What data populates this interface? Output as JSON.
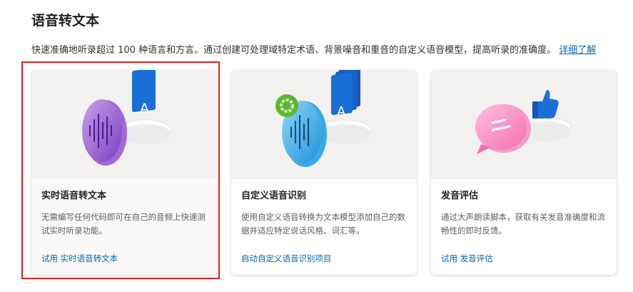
{
  "header": {
    "title": "语音转文本",
    "description": "快速准确地听录超过 100 种语言和方言。通过创建可处理域特定术语、背景噪音和重音的自定义语音模型，提高听录的准确度。",
    "learn_more": "详细了解"
  },
  "cards": [
    {
      "title": "实时语音转文本",
      "description": "无需编写任何代码即可在自己的音频上快速测试实时听录功能。",
      "link": "试用 实时语音转文本"
    },
    {
      "title": "自定义语音识别",
      "description": "使用自定义语音转换为文本模型添加自己的数据并适应特定说话风格、词汇等。",
      "link": "启动自定义语音识别项目"
    },
    {
      "title": "发音评估",
      "description": "通过大声朗读脚本，获取有关发音准确度和流畅性的即时反馈。",
      "link": "试用 发音评估"
    }
  ]
}
